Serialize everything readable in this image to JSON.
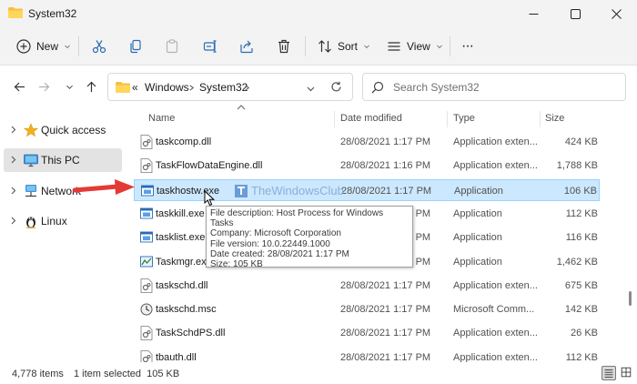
{
  "window": {
    "title": "System32"
  },
  "toolbar": {
    "new_label": "New",
    "sort_label": "Sort",
    "view_label": "View",
    "more_label": "···"
  },
  "address": {
    "overflow": "«",
    "crumbs": [
      "Windows",
      "System32"
    ]
  },
  "search": {
    "placeholder": "Search System32"
  },
  "sidebar": {
    "items": [
      {
        "label": "Quick access",
        "icon": "star-icon"
      },
      {
        "label": "This PC",
        "icon": "monitor-icon"
      },
      {
        "label": "Network",
        "icon": "network-icon"
      },
      {
        "label": "Linux",
        "icon": "penguin-icon"
      }
    ]
  },
  "columns": {
    "name": "Name",
    "date": "Date modified",
    "type": "Type",
    "size": "Size"
  },
  "files": [
    {
      "name": "taskcomp.dll",
      "date": "28/08/2021 1:17 PM",
      "type": "Application exten...",
      "size": "424 KB",
      "icon": "dll-icon"
    },
    {
      "name": "TaskFlowDataEngine.dll",
      "date": "28/08/2021 1:16 PM",
      "type": "Application exten...",
      "size": "1,788 KB",
      "icon": "dll-icon"
    },
    {
      "name": "taskhostw.exe",
      "date": "28/08/2021 1:17 PM",
      "type": "Application",
      "size": "106 KB",
      "icon": "exe-icon",
      "selected": true
    },
    {
      "name": "taskkill.exe",
      "date": "28/08/2021 1:17 PM",
      "type": "Application",
      "size": "112 KB",
      "icon": "exe-icon"
    },
    {
      "name": "tasklist.exe",
      "date": "28/08/2021 1:17 PM",
      "type": "Application",
      "size": "116 KB",
      "icon": "exe-icon"
    },
    {
      "name": "Taskmgr.exe",
      "date": "28/08/2021 1:17 PM",
      "type": "Application",
      "size": "1,462 KB",
      "icon": "taskmgr-icon"
    },
    {
      "name": "taskschd.dll",
      "date": "28/08/2021 1:17 PM",
      "type": "Application exten...",
      "size": "675 KB",
      "icon": "dll-icon"
    },
    {
      "name": "taskschd.msc",
      "date": "28/08/2021 1:17 PM",
      "type": "Microsoft Comm...",
      "size": "142 KB",
      "icon": "msc-icon"
    },
    {
      "name": "TaskSchdPS.dll",
      "date": "28/08/2021 1:17 PM",
      "type": "Application exten...",
      "size": "26 KB",
      "icon": "dll-icon"
    },
    {
      "name": "tbauth.dll",
      "date": "28/08/2021 1:17 PM",
      "type": "Application exten...",
      "size": "112 KB",
      "icon": "dll-icon"
    }
  ],
  "tooltip": {
    "lines": [
      "File description: Host Process for Windows Tasks",
      "Company: Microsoft Corporation",
      "File version: 10.0.22449.1000",
      "Date created: 28/08/2021 1:17 PM",
      "Size: 105 KB"
    ]
  },
  "watermark": {
    "text": "TheWindowsClub"
  },
  "status": {
    "items": "4,778 items",
    "selected": "1 item selected  105 KB"
  },
  "colors": {
    "selection": "#cce8ff",
    "selection_border": "#99d1ff",
    "accent": "#0067c0",
    "arrow": "#e53935",
    "folder": "#f5c13b"
  }
}
